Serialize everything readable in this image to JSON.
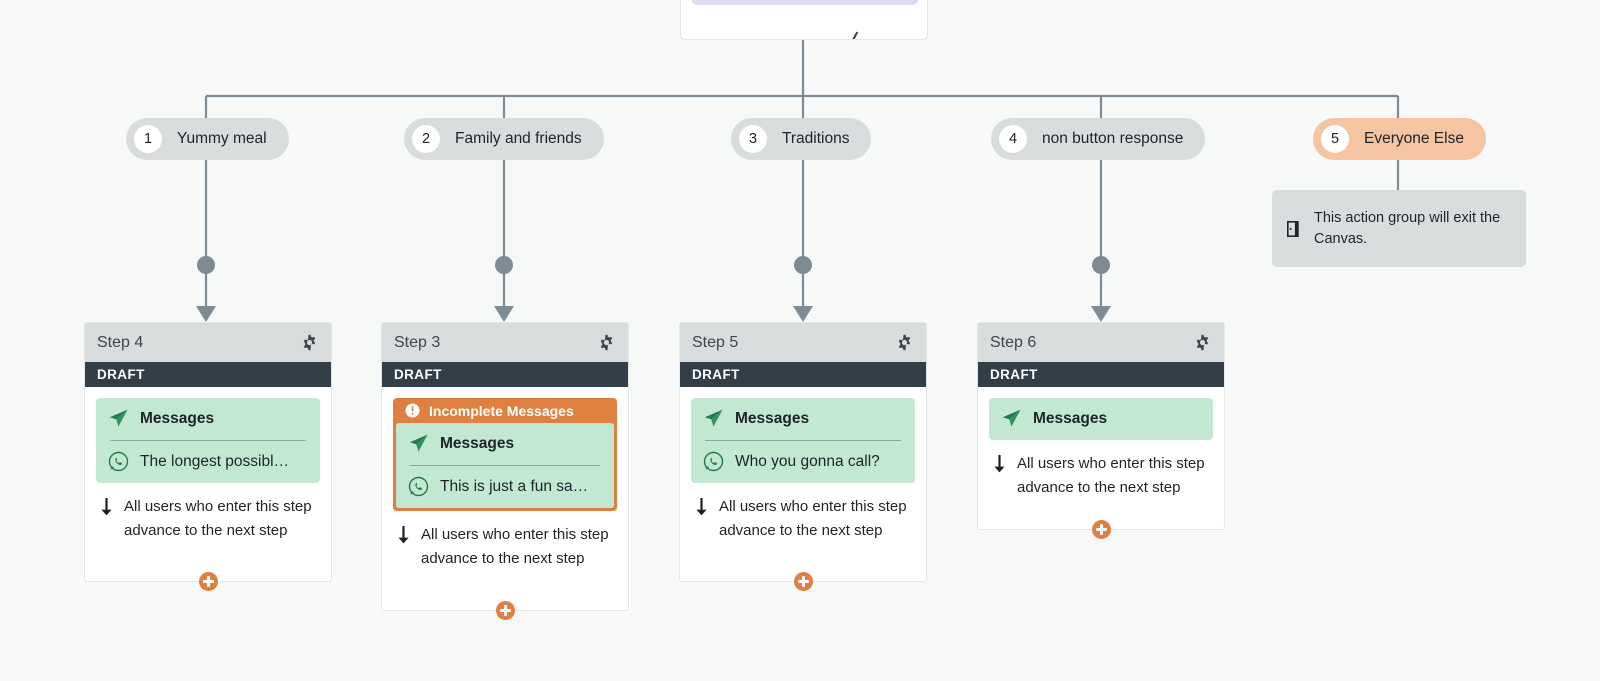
{
  "canvas": {
    "background_color": "#f7f8f8",
    "connector_color": "#7d8b94"
  },
  "parent_card": {
    "name": "parent-step-card-partial",
    "band_color": "#dcdcef"
  },
  "branches": [
    {
      "number": "1",
      "label": "Yummy meal",
      "accent": false
    },
    {
      "number": "2",
      "label": "Family and friends",
      "accent": false
    },
    {
      "number": "3",
      "label": "Traditions",
      "accent": false
    },
    {
      "number": "4",
      "label": "non button response",
      "accent": false
    },
    {
      "number": "5",
      "label": "Everyone Else",
      "accent": true
    }
  ],
  "exit_note": {
    "icon": "door-exit-icon",
    "text": "This action group will exit the Canvas."
  },
  "common": {
    "draft_label": "DRAFT",
    "messages_label": "Messages",
    "incomplete_label": "Incomplete Messages",
    "advance_text": "All users who enter this step advance to the next step",
    "gear_icon": "gear-icon",
    "plane_icon": "paper-plane-icon",
    "whatsapp_icon": "whatsapp-icon",
    "warning_icon": "warning-icon",
    "down_arrow_icon": "down-arrow-icon",
    "add_icon": "plus-circle-icon",
    "accent_color": "#e08040",
    "message_block_color": "#c3e8d2",
    "draft_bar_color": "#333f48",
    "header_color": "#d9dcdd"
  },
  "steps": [
    {
      "title": "Step 4",
      "draft": "DRAFT",
      "incomplete": false,
      "messages_label": "Messages",
      "message_text": "The longest possibl…",
      "has_message_row": true,
      "advance_text": "All users who enter this step advance to the next step"
    },
    {
      "title": "Step 3",
      "draft": "DRAFT",
      "incomplete": true,
      "incomplete_label": "Incomplete Messages",
      "messages_label": "Messages",
      "message_text": "This is just a fun sa…",
      "has_message_row": true,
      "advance_text": "All users who enter this step advance to the next step"
    },
    {
      "title": "Step 5",
      "draft": "DRAFT",
      "incomplete": false,
      "messages_label": "Messages",
      "message_text": "Who you gonna call?",
      "has_message_row": true,
      "advance_text": "All users who enter this step advance to the next step"
    },
    {
      "title": "Step 6",
      "draft": "DRAFT",
      "incomplete": false,
      "messages_label": "Messages",
      "message_text": "",
      "has_message_row": false,
      "advance_text": "All users who enter this step advance to the next step"
    }
  ]
}
